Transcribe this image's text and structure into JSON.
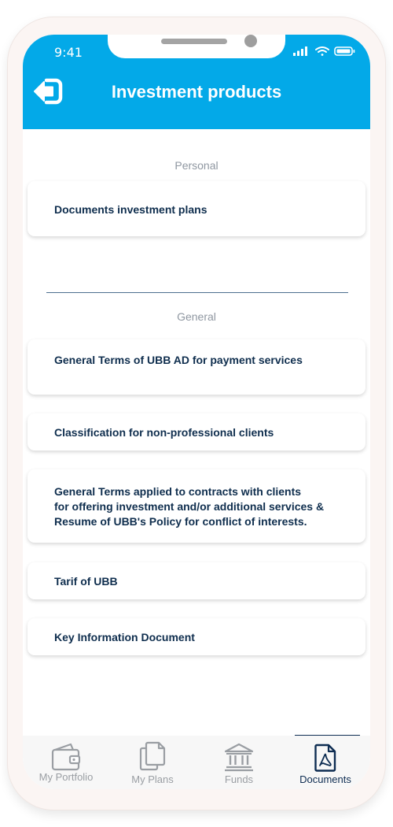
{
  "status_bar": {
    "time": "9:41"
  },
  "header": {
    "title": "Investment products"
  },
  "sections": [
    {
      "label": "Personal",
      "items": [
        {
          "lines": [
            "Documents investment plans"
          ]
        }
      ]
    },
    {
      "label": "General",
      "items": [
        {
          "lines": [
            "General Terms of UBB AD for payment services"
          ]
        },
        {
          "lines": [
            "Classification for non-professional clients"
          ]
        },
        {
          "lines": [
            "General Terms applied to contracts with clients",
            "for offering investment and/or additional services &",
            "Resume of UBB's Policy for conflict of interests."
          ]
        },
        {
          "lines": [
            "Tarif of UBB"
          ]
        },
        {
          "lines": [
            "Key Information Document"
          ]
        }
      ]
    }
  ],
  "tabbar": {
    "tabs": [
      {
        "label": "My Portfolio",
        "icon": "wallet-icon",
        "active": false
      },
      {
        "label": "My Plans",
        "icon": "documents-icon",
        "active": false
      },
      {
        "label": "Funds",
        "icon": "bank-icon",
        "active": false
      },
      {
        "label": "Documents",
        "icon": "pdf-file-icon",
        "active": true
      }
    ]
  },
  "colors": {
    "header_bg": "#03a9e8",
    "text_dark": "#0f2e4e",
    "section_label": "#8f97a1",
    "tab_inactive": "#9a9ea3",
    "tab_active": "#0e2d52"
  }
}
